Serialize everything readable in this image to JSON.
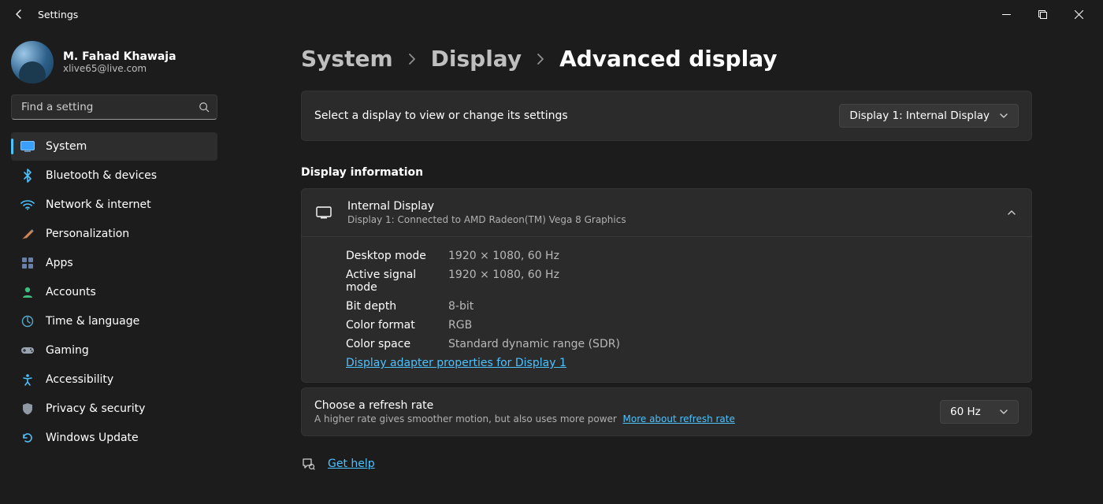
{
  "app": {
    "title": "Settings"
  },
  "profile": {
    "name": "M. Fahad Khawaja",
    "email": "xlive65@live.com"
  },
  "search": {
    "placeholder": "Find a setting"
  },
  "nav": {
    "items": [
      {
        "label": "System"
      },
      {
        "label": "Bluetooth & devices"
      },
      {
        "label": "Network & internet"
      },
      {
        "label": "Personalization"
      },
      {
        "label": "Apps"
      },
      {
        "label": "Accounts"
      },
      {
        "label": "Time & language"
      },
      {
        "label": "Gaming"
      },
      {
        "label": "Accessibility"
      },
      {
        "label": "Privacy & security"
      },
      {
        "label": "Windows Update"
      }
    ]
  },
  "breadcrumb": {
    "parts": [
      "System",
      "Display",
      "Advanced display"
    ]
  },
  "selector": {
    "label": "Select a display to view or change its settings",
    "value": "Display 1: Internal Display"
  },
  "section": {
    "display_info": "Display information"
  },
  "display_info": {
    "title": "Internal Display",
    "subtitle": "Display 1: Connected to AMD Radeon(TM) Vega 8 Graphics",
    "rows": [
      {
        "k": "Desktop mode",
        "v": "1920 × 1080, 60 Hz"
      },
      {
        "k": "Active signal mode",
        "v": "1920 × 1080, 60 Hz"
      },
      {
        "k": "Bit depth",
        "v": "8-bit"
      },
      {
        "k": "Color format",
        "v": "RGB"
      },
      {
        "k": "Color space",
        "v": "Standard dynamic range (SDR)"
      }
    ],
    "adapter_link": "Display adapter properties for Display 1"
  },
  "refresh": {
    "title": "Choose a refresh rate",
    "subtitle": "A higher rate gives smoother motion, but also uses more power",
    "more_link": "More about refresh rate",
    "value": "60 Hz"
  },
  "help": {
    "label": "Get help"
  }
}
